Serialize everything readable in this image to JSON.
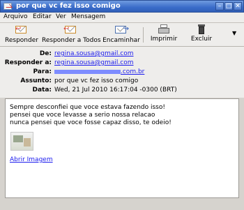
{
  "window": {
    "title": "por que vc fez isso comigo"
  },
  "menu": [
    "Arquivo",
    "Editar",
    "Ver",
    "Mensagem"
  ],
  "toolbar": {
    "reply": "Responder",
    "reply_all": "Responder a Todos",
    "forward": "Encaminhar",
    "print": "Imprimir",
    "delete": "Excluir"
  },
  "headers": {
    "from_label": "De:",
    "from_value": "regina.sousa@gmail.com",
    "reply_to_label": "Responder a:",
    "reply_to_value": "regina.sousa@gmail.com",
    "to_label": "Para:",
    "to_value_suffix": ".com.br",
    "subject_label": "Assunto:",
    "subject_value": "por que vc fez isso comigo",
    "date_label": "Data:",
    "date_value": "Wed, 21 Jul 2010 16:17:04 -0300 (BRT)"
  },
  "message": {
    "line1": "Sempre desconfiei que voce estava fazendo isso!",
    "line2": "pensei que voce levasse a serio nossa relacao",
    "line3": "nunca pensei que voce fosse capaz disso, te odeio!",
    "open_image": "Abrir Imagem"
  },
  "colors": {
    "titlebar": "#3a6cc9",
    "link": "#1a1aee",
    "redacted": "#7d8cff"
  }
}
